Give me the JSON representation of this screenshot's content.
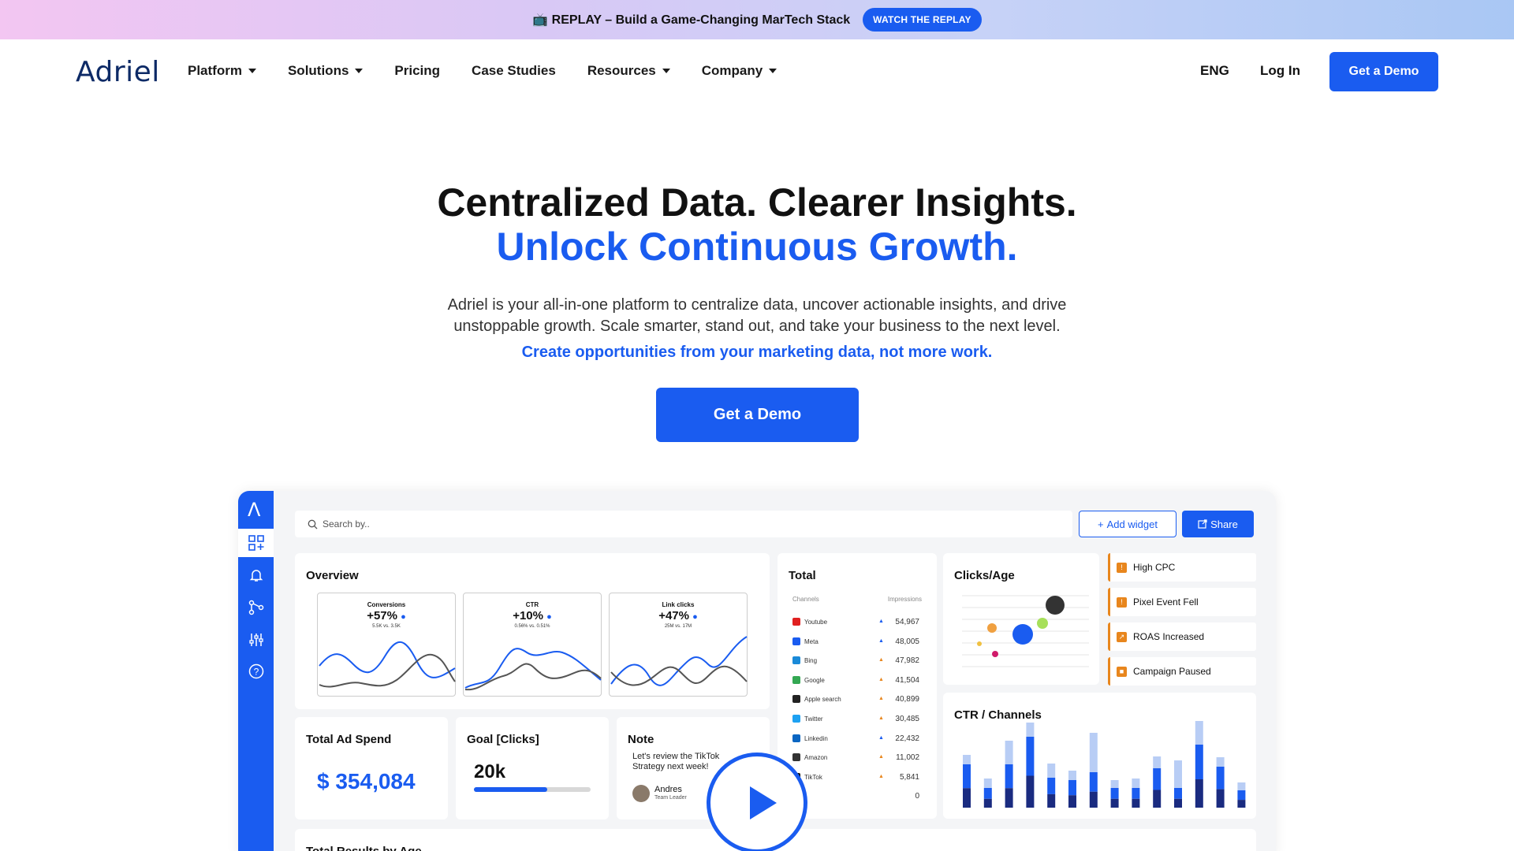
{
  "banner": {
    "text": "📺 REPLAY – Build a Game-Changing MarTech Stack",
    "button": "WATCH THE REPLAY"
  },
  "nav": {
    "logo": "Adriel",
    "items": [
      {
        "label": "Platform",
        "dropdown": true
      },
      {
        "label": "Solutions",
        "dropdown": true
      },
      {
        "label": "Pricing",
        "dropdown": false
      },
      {
        "label": "Case Studies",
        "dropdown": false
      },
      {
        "label": "Resources",
        "dropdown": true
      },
      {
        "label": "Company",
        "dropdown": true
      }
    ],
    "lang": "ENG",
    "login": "Log In",
    "demo": "Get a Demo"
  },
  "hero": {
    "title_line1": "Centralized Data. Clearer Insights.",
    "title_line2": "Unlock Continuous Growth.",
    "paragraph": "Adriel is your all-in-one platform to centralize data, uncover actionable insights, and drive unstoppable growth. Scale smarter, stand out, and take your business to the next level.",
    "link": "Create opportunities from your marketing data, not more work.",
    "cta": "Get a Demo"
  },
  "dashboard": {
    "search_placeholder": "Search by..",
    "add_widget": "Add widget",
    "share": "Share",
    "overview": {
      "title": "Overview",
      "cards": [
        {
          "label": "Conversions",
          "value": "+57%",
          "sub": "5.5K vs. 3.5K"
        },
        {
          "label": "CTR",
          "value": "+10%",
          "sub": "0.56% vs. 0.51%"
        },
        {
          "label": "Link clicks",
          "value": "+47%",
          "sub": "25M vs. 17M"
        }
      ]
    },
    "total": {
      "title": "Total",
      "col_channels": "Channels",
      "col_impressions": "Impressions",
      "rows": [
        {
          "name": "Youtube",
          "value": "54,967",
          "icon_color": "#e02020"
        },
        {
          "name": "Meta",
          "value": "48,005",
          "icon_color": "#1a5cf0"
        },
        {
          "name": "Bing",
          "value": "47,982",
          "icon_color": "#1a8ad8"
        },
        {
          "name": "Google",
          "value": "41,504",
          "icon_color": "#34a853"
        },
        {
          "name": "Apple search",
          "value": "40,899",
          "icon_color": "#222222"
        },
        {
          "name": "Twitter",
          "value": "30,485",
          "icon_color": "#1da1f2"
        },
        {
          "name": "Linkedin",
          "value": "22,432",
          "icon_color": "#0a66c2"
        },
        {
          "name": "Amazon",
          "value": "11,002",
          "icon_color": "#333333"
        },
        {
          "name": "TikTok",
          "value": "5,841",
          "icon_color": "#111111"
        },
        {
          "name": "",
          "value": "0",
          "icon_color": "#ffffff"
        }
      ]
    },
    "clicks_age": {
      "title": "Clicks/Age"
    },
    "alerts": [
      "High CPC",
      "Pixel Event Fell",
      "ROAS Increased",
      "Campaign Paused"
    ],
    "total_ad_spend": {
      "title": "Total Ad Spend",
      "value": "$ 354,084"
    },
    "goal": {
      "title": "Goal [Clicks]",
      "value": "20k",
      "progress": 0.63
    },
    "note": {
      "title": "Note",
      "text": "Let's review the TikTok Strategy next week!",
      "author": "Andres",
      "role": "Team Leader"
    },
    "ctr_channels": {
      "title": "CTR / Channels",
      "bars": [
        {
          "dark": 0.55,
          "light": 0.12
        },
        {
          "dark": 0.25,
          "light": 0.12
        },
        {
          "dark": 0.55,
          "light": 0.3
        },
        {
          "dark": 0.9,
          "light": 0.18
        },
        {
          "dark": 0.38,
          "light": 0.18
        },
        {
          "dark": 0.35,
          "light": 0.12
        },
        {
          "dark": 0.45,
          "light": 0.5
        },
        {
          "dark": 0.25,
          "light": 0.1
        },
        {
          "dark": 0.25,
          "light": 0.12
        },
        {
          "dark": 0.5,
          "light": 0.15
        },
        {
          "dark": 0.25,
          "light": 0.35
        },
        {
          "dark": 0.8,
          "light": 0.3
        },
        {
          "dark": 0.52,
          "light": 0.12
        },
        {
          "dark": 0.22,
          "light": 0.1
        }
      ]
    },
    "results_by_age": {
      "title": "Total Results by Age"
    }
  }
}
